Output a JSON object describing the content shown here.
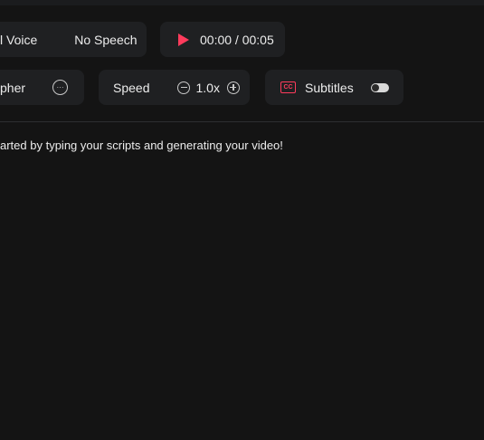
{
  "voice": {
    "label": "l Voice",
    "value": "No Speech"
  },
  "player": {
    "time": "00:00 / 00:05"
  },
  "avatar": {
    "label": "pher"
  },
  "speed": {
    "label": "Speed",
    "value": "1.0x"
  },
  "subtitles": {
    "label": "Subtitles",
    "enabled": false
  },
  "hint": "arted by typing your scripts and generating your video!",
  "colors": {
    "accent": "#ff3b5c",
    "background": "#141414",
    "panel": "#1f2022"
  },
  "icons": {
    "play": "play-icon",
    "more": "more-icon",
    "minus": "minus-icon",
    "plus": "plus-icon",
    "cc": "cc-icon",
    "toggle": "toggle-switch"
  }
}
